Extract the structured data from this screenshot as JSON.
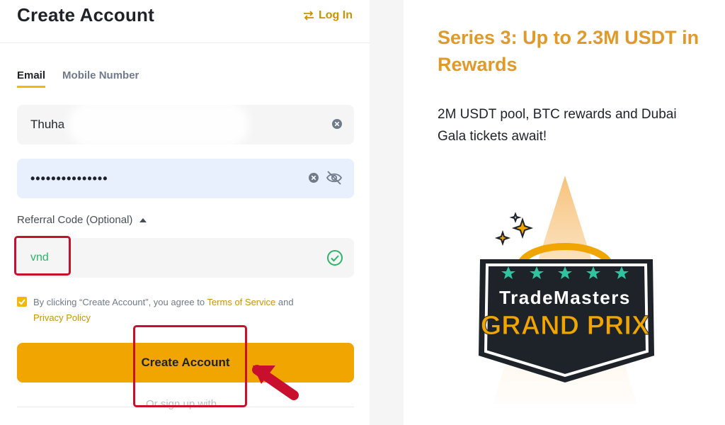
{
  "header": {
    "title": "Create Account",
    "login_link": "Log In"
  },
  "tabs": [
    {
      "label": "Email",
      "active": true
    },
    {
      "label": "Mobile Number",
      "active": false
    }
  ],
  "form": {
    "email_value": "Thuha",
    "password_value": "•••••••••••••••",
    "referral_label": "Referral Code (Optional)",
    "referral_value": "vnd",
    "agree_prefix": "By clicking “Create Account”, you agree to ",
    "terms_link": "Terms of Service",
    "agree_and": " and",
    "privacy_link": "Privacy Policy",
    "checkbox_checked": true,
    "create_button": "Create Account",
    "or_sign_up": "Or sign up with"
  },
  "promo": {
    "title": "Series 3: Up to 2.3M USDT in Rewards",
    "text": "2M USDT pool, BTC rewards and Dubai Gala tickets await!",
    "badge_line1": "TradeMasters",
    "badge_line2": "GRAND PRIX"
  },
  "colors": {
    "accent": "#f0b90b",
    "button": "#f0a500",
    "link": "#c99400",
    "promo_title": "#e09a2a",
    "annotation": "#c8102e",
    "success": "#2db36a"
  }
}
